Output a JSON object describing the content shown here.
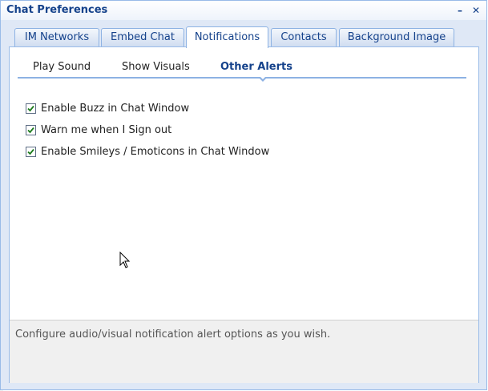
{
  "window": {
    "title": "Chat Preferences",
    "minimize_glyph": "–",
    "close_glyph": "✕"
  },
  "tabs": [
    {
      "label": "IM Networks",
      "active": false
    },
    {
      "label": "Embed Chat",
      "active": false
    },
    {
      "label": "Notifications",
      "active": true
    },
    {
      "label": "Contacts",
      "active": false
    },
    {
      "label": "Background Image",
      "active": false
    }
  ],
  "subtabs": [
    {
      "label": "Play Sound",
      "active": false
    },
    {
      "label": "Show Visuals",
      "active": false
    },
    {
      "label": "Other Alerts",
      "active": true
    }
  ],
  "options": [
    {
      "label": "Enable Buzz in Chat Window",
      "checked": true
    },
    {
      "label": "Warn me when I Sign out",
      "checked": true
    },
    {
      "label": "Enable Smileys / Emoticons in Chat Window",
      "checked": true
    }
  ],
  "footer": {
    "text": "Configure audio/visual notification alert options as you wish."
  },
  "colors": {
    "accent": "#15428b",
    "border": "#99bbe8"
  }
}
